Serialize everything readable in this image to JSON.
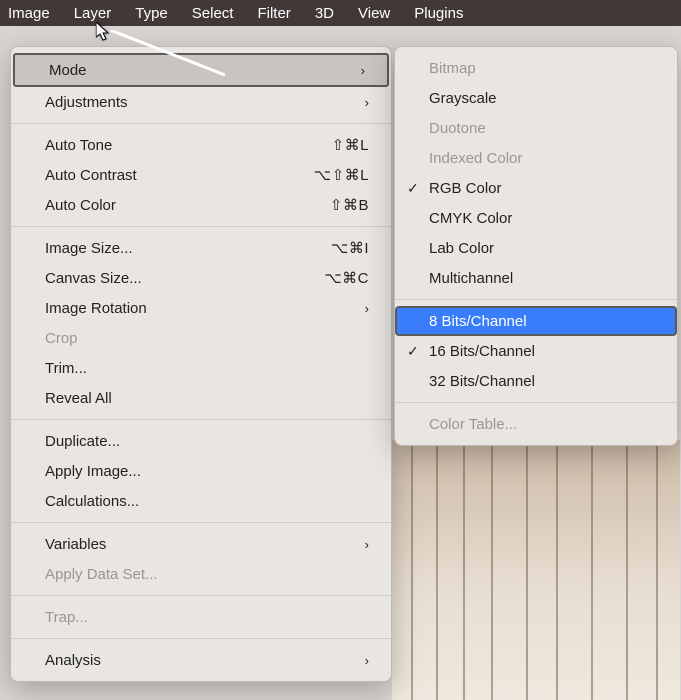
{
  "menubar": {
    "items": [
      "Image",
      "Layer",
      "Type",
      "Select",
      "Filter",
      "3D",
      "View",
      "Plugins"
    ]
  },
  "main_menu": {
    "mode": "Mode",
    "adjustments": "Adjustments",
    "auto_tone": {
      "label": "Auto Tone",
      "shortcut": "⇧⌘L"
    },
    "auto_contrast": {
      "label": "Auto Contrast",
      "shortcut": "⌥⇧⌘L"
    },
    "auto_color": {
      "label": "Auto Color",
      "shortcut": "⇧⌘B"
    },
    "image_size": {
      "label": "Image Size...",
      "shortcut": "⌥⌘I"
    },
    "canvas_size": {
      "label": "Canvas Size...",
      "shortcut": "⌥⌘C"
    },
    "image_rotation": "Image Rotation",
    "crop": "Crop",
    "trim": "Trim...",
    "reveal_all": "Reveal All",
    "duplicate": "Duplicate...",
    "apply_image": "Apply Image...",
    "calculations": "Calculations...",
    "variables": "Variables",
    "apply_data_set": "Apply Data Set...",
    "trap": "Trap...",
    "analysis": "Analysis"
  },
  "mode_submenu": {
    "bitmap": "Bitmap",
    "grayscale": "Grayscale",
    "duotone": "Duotone",
    "indexed": "Indexed Color",
    "rgb": "RGB Color",
    "cmyk": "CMYK Color",
    "lab": "Lab Color",
    "multichannel": "Multichannel",
    "bits8": "8 Bits/Channel",
    "bits16": "16 Bits/Channel",
    "bits32": "32 Bits/Channel",
    "color_table": "Color Table..."
  }
}
